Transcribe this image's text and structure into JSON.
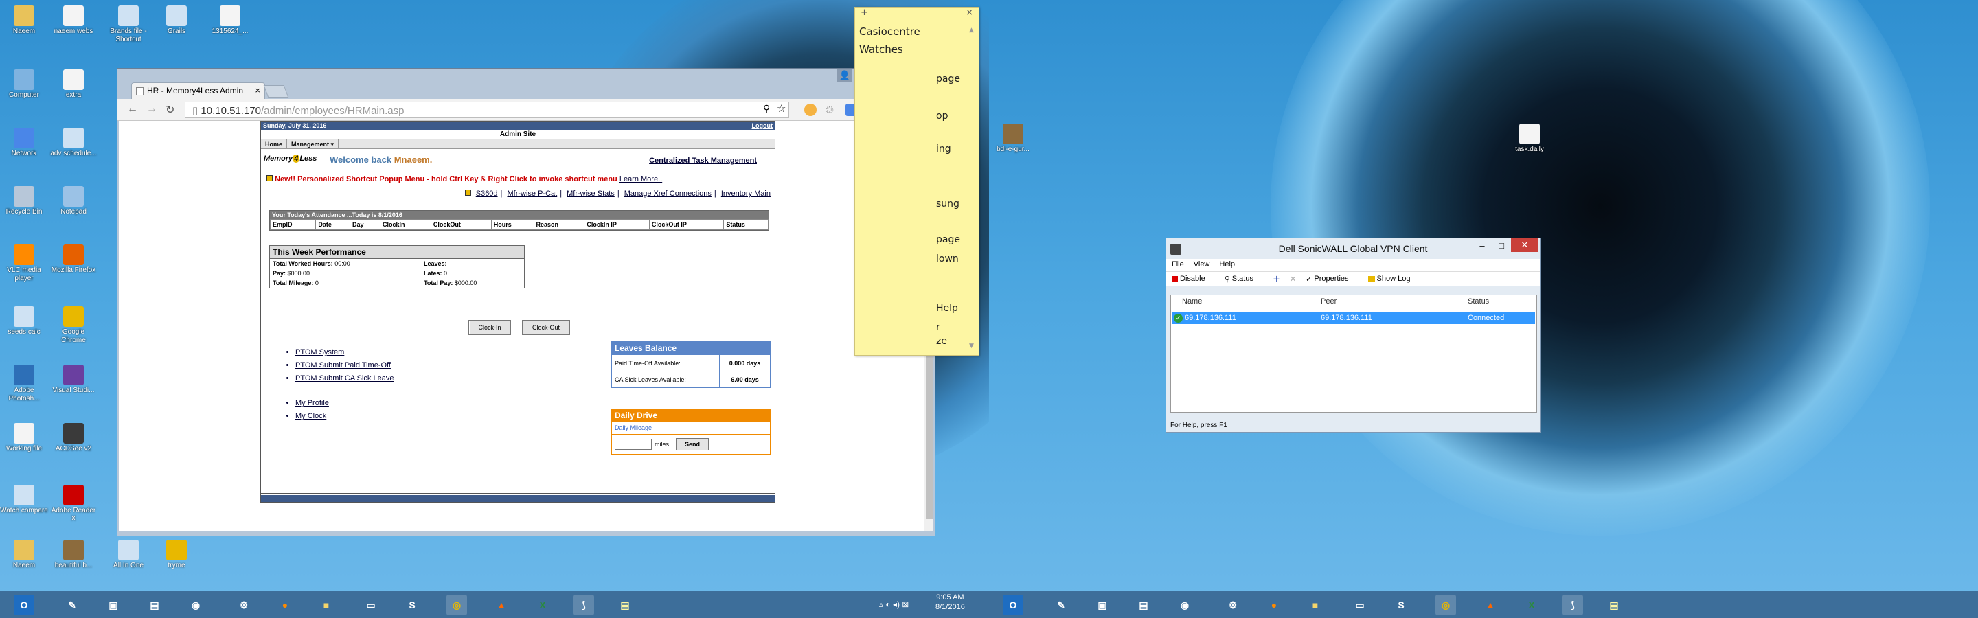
{
  "desktop_left": {
    "icons": [
      {
        "label": "Naeem",
        "name": "user-folder-icon"
      },
      {
        "label": "naeem webs",
        "name": "document-icon"
      },
      {
        "label": "Brands file - Shortcut",
        "name": "shortcut-icon"
      },
      {
        "label": "Grails",
        "name": "shortcut-icon"
      },
      {
        "label": "1315624_...",
        "name": "document-icon"
      },
      {
        "label": "Computer",
        "name": "computer-icon"
      },
      {
        "label": "extra",
        "name": "document-icon"
      },
      {
        "label": "Network",
        "name": "network-icon"
      },
      {
        "label": "adv schedule...",
        "name": "shortcut-icon"
      },
      {
        "label": "Recycle Bin",
        "name": "recycle-bin-icon"
      },
      {
        "label": "Notepad",
        "name": "notepad-icon"
      },
      {
        "label": "VLC media player",
        "name": "vlc-icon"
      },
      {
        "label": "Mozilla Firefox",
        "name": "firefox-icon"
      },
      {
        "label": "seeds calc",
        "name": "shortcut-icon"
      },
      {
        "label": "Google Chrome",
        "name": "chrome-icon"
      },
      {
        "label": "Adobe Photosh...",
        "name": "photoshop-icon"
      },
      {
        "label": "Visual Studi...",
        "name": "visual-studio-icon"
      },
      {
        "label": "Working file",
        "name": "document-icon"
      },
      {
        "label": "ACDSee v2",
        "name": "acdsee-icon"
      },
      {
        "label": "Watch compare",
        "name": "shortcut-icon"
      },
      {
        "label": "Adobe Reader X",
        "name": "adobe-reader-icon"
      },
      {
        "label": "Naeem",
        "name": "user-folder-icon"
      },
      {
        "label": "beautiful b...",
        "name": "image-icon"
      },
      {
        "label": "All In One",
        "name": "shortcut-icon"
      },
      {
        "label": "tryme",
        "name": "chrome-icon"
      }
    ]
  },
  "desktop_right": {
    "icons": [
      {
        "label": "bdi-e-gur...",
        "name": "image-icon"
      },
      {
        "label": "task.daily",
        "name": "document-icon"
      }
    ]
  },
  "browser": {
    "tab_title": "HR - Memory4Less Admin",
    "url_host": "10.10.51.170",
    "url_path": "/admin/employees/HRMain.asp"
  },
  "hr_page": {
    "date": "Sunday, July 31, 2016",
    "logout": "Logout",
    "site_title": "Admin Site",
    "menu": [
      "Home",
      "Management"
    ],
    "logo_a": "Memory",
    "logo_b": "4",
    "logo_c": "Less",
    "welcome_prefix": "Welcome back",
    "welcome_name": "Mnaeem.",
    "ctm_link": "Centralized Task Management",
    "new_notice": "New!! Personalized Shortcut Popup Menu - hold Ctrl Key & Right Click to invoke shortcut menu",
    "learn_more": "Learn More..",
    "quick_links": [
      "S360d",
      "Mfr-wise P-Cat",
      "Mfr-wise Stats",
      "Manage Xref Connections",
      "Inventory Main"
    ],
    "attendance_header": "Your Today's Attendance ...Today is 8/1/2016",
    "attendance_columns": [
      "EmpID",
      "Date",
      "Day",
      "ClockIn",
      "ClockOut",
      "Hours",
      "Reason",
      "ClockIn IP",
      "ClockOut IP",
      "Status"
    ],
    "perf_title": "This Week Performance",
    "perf_worked_label": "Total Worked Hours:",
    "perf_worked_value": "00:00",
    "perf_leaves_label": "Leaves:",
    "perf_leaves_value": "",
    "perf_pay_label": "Pay:",
    "perf_pay_value": "$000.00",
    "perf_lates_label": "Lates:",
    "perf_lates_value": "0",
    "perf_mileage_label": "Total Mileage:",
    "perf_mileage_value": "0",
    "perf_totalpay_label": "Total Pay:",
    "perf_totalpay_value": "$000.00",
    "clock_in": "Clock-In",
    "clock_out": "Clock-Out",
    "link_group1": [
      "PTOM System",
      "PTOM Submit Paid Time-Off",
      "PTOM Submit CA Sick Leave"
    ],
    "link_group2": [
      "My Profile",
      "My Clock"
    ],
    "leaves_title": "Leaves Balance",
    "leaves_pto_label": "Paid Time-Off Available:",
    "leaves_pto_value": "0.000 days",
    "leaves_sick_label": "CA Sick Leaves Available:",
    "leaves_sick_value": "6.00 days",
    "drive_title": "Daily Drive",
    "drive_sub": "Daily Mileage",
    "drive_unit": "miles",
    "drive_send": "Send"
  },
  "sticky": {
    "line1": "Casiocentre",
    "line2": "Watches",
    "fragments": [
      "page",
      "op",
      "ing",
      "sung",
      "page",
      "lown",
      "Help",
      "r",
      "ze"
    ]
  },
  "vpn": {
    "title": "Dell SonicWALL Global VPN Client",
    "menu": [
      "File",
      "View",
      "Help"
    ],
    "tools": [
      "Disable",
      "Status",
      "Properties",
      "Show Log"
    ],
    "columns": [
      "Name",
      "Peer",
      "Status"
    ],
    "row": {
      "name": "69.178.136.111",
      "peer": "69.178.136.111",
      "status": "Connected"
    },
    "statusbar": "For Help, press F1"
  },
  "taskbar": {
    "time": "9:05 AM",
    "date": "8/1/2016"
  },
  "colors": {
    "desktop": "#3f9ad8",
    "taskbar": "#3d6e9a",
    "hr_nav": "#3d5a8a",
    "vpn_selection": "#3399ff",
    "sticky": "#fdf6a3"
  }
}
